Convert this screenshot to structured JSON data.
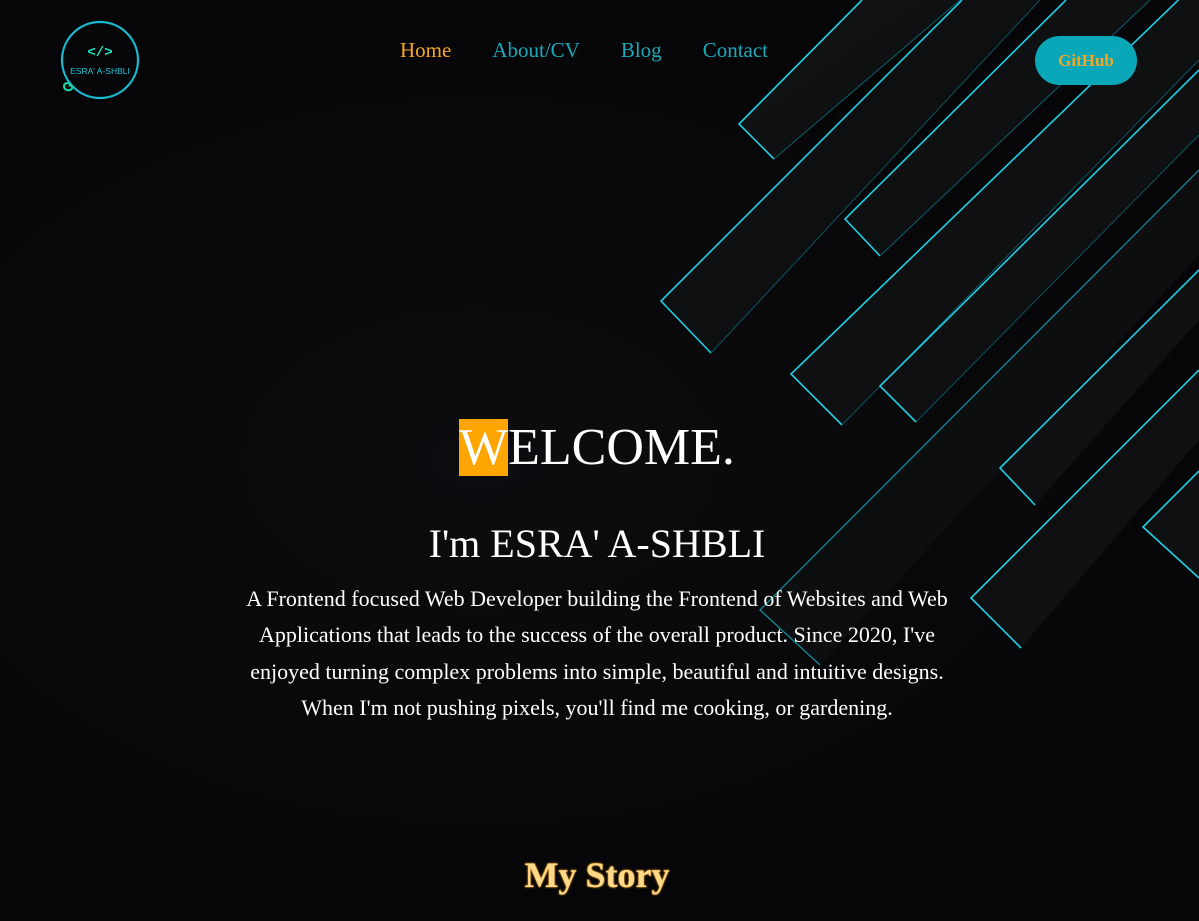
{
  "logo": {
    "code_glyph": "</>",
    "name": "ESRA' A-SHBLI"
  },
  "nav": {
    "items": [
      {
        "label": "Home",
        "active": true
      },
      {
        "label": "About/CV",
        "active": false
      },
      {
        "label": "Blog",
        "active": false
      },
      {
        "label": "Contact",
        "active": false
      }
    ]
  },
  "header": {
    "github_label": "GitHub"
  },
  "hero": {
    "welcome_first": "W",
    "welcome_rest": "ELCOME.",
    "name_line": "I'm ESRA' A-SHBLI",
    "bio": "A Frontend focused Web Developer building the Frontend of Websites and Web Applications that leads to the success of the overall product. Since 2020, I've enjoyed turning complex problems into simple, beautiful and intuitive designs. When I'm not pushing pixels, you'll find me cooking, or gardening."
  },
  "story": {
    "title": "My Story"
  },
  "colors": {
    "background": "#070709",
    "accent_teal": "#0aa7b8",
    "accent_orange": "#f6a623",
    "highlight": "#ffa500",
    "text": "#ffffff"
  }
}
